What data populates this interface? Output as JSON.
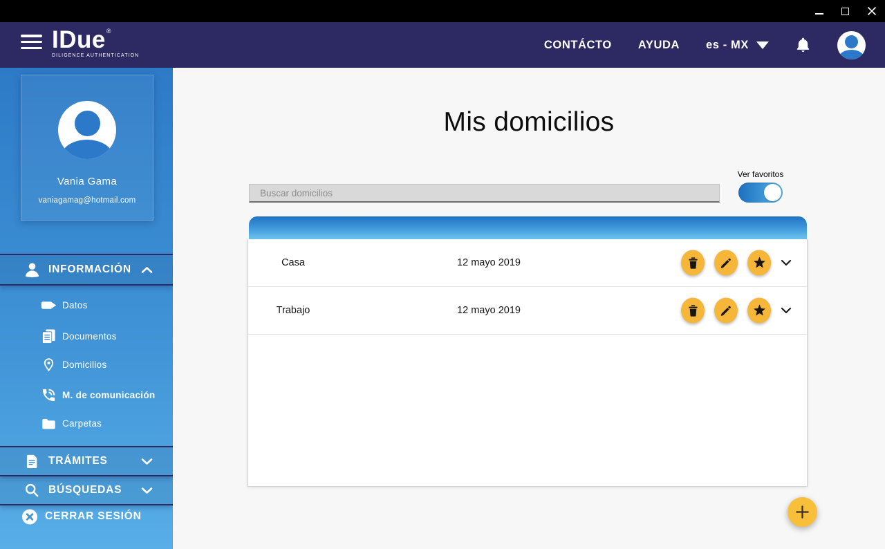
{
  "titlebar": {
    "controls": [
      {
        "name": "minimize"
      },
      {
        "name": "maximize"
      },
      {
        "name": "close"
      }
    ]
  },
  "header": {
    "menu_icon": "hamburger-icon",
    "logo": {
      "title": "IDue",
      "registered_mark": "®",
      "subtitle": "DILIGENCE AUTHENTICATION"
    },
    "links": [
      {
        "label": "CONTÁCTO"
      },
      {
        "label": "AYUDA"
      }
    ],
    "language_selector": {
      "value": "es - MX",
      "icon": "triangle-down-icon"
    },
    "notification_icon": "bell-icon",
    "avatar_icon": "user-icon"
  },
  "sidebar": {
    "profile": {
      "name": "Vania Gama",
      "email": "vaniagamag@hotmail.com",
      "avatar_icon": "user-icon"
    },
    "sections": [
      {
        "label": "INFORMACIÓN",
        "icon": "user-icon",
        "state": "expanded",
        "chevron": "chevron-up-icon",
        "items": [
          {
            "label": "Datos",
            "icon": "id-card-icon"
          },
          {
            "label": "Documentos",
            "icon": "documents-icon"
          },
          {
            "label": "Domicilios",
            "icon": "location-pin-icon"
          },
          {
            "label": "M. de comunicación",
            "icon": "phone-icon",
            "emphasis": true
          },
          {
            "label": "Carpetas",
            "icon": "folder-icon"
          }
        ]
      },
      {
        "label": "TRÁMITES",
        "icon": "document-icon",
        "state": "collapsed",
        "chevron": "chevron-down-icon",
        "items": []
      },
      {
        "label": "BÚSQUEDAS",
        "icon": "search-icon",
        "state": "collapsed",
        "chevron": "chevron-down-icon",
        "items": []
      }
    ],
    "logout": {
      "label": "CERRAR SESIÓN",
      "icon": "close-circle-icon"
    }
  },
  "main": {
    "title": "Mis domicilios",
    "search": {
      "placeholder": "Buscar domicilios"
    },
    "favorites_toggle": {
      "label": "Ver favoritos",
      "state": "on"
    },
    "table": {
      "rows": [
        {
          "name": "Casa",
          "date": "12 mayo 2019",
          "actions": [
            "delete",
            "edit",
            "favorite"
          ],
          "expand_icon": "chevron-down-icon"
        },
        {
          "name": "Trabajo",
          "date": "12 mayo 2019",
          "actions": [
            "delete",
            "edit",
            "favorite"
          ],
          "expand_icon": "chevron-down-icon"
        }
      ]
    },
    "add_button": {
      "label": "+",
      "icon": "plus-icon"
    }
  },
  "colors": {
    "titlebar": "#000000",
    "header_navy": "#2d2963",
    "sidebar_top": "#2d7ac7",
    "sidebar_bottom": "#58aee7",
    "section_border": "#2d2963",
    "avatar_blue": "#2b79c8",
    "table_head_top": "#1f72c4",
    "table_head_bottom": "#71c5f0",
    "toggle_left": "#1d6fc0",
    "toggle_right": "#56b4e7",
    "action_yellow": "#f5b63a",
    "fab_yellow": "#f8bf3b",
    "main_bg": "#f7f7f8",
    "search_bg": "#d9d9d9"
  }
}
